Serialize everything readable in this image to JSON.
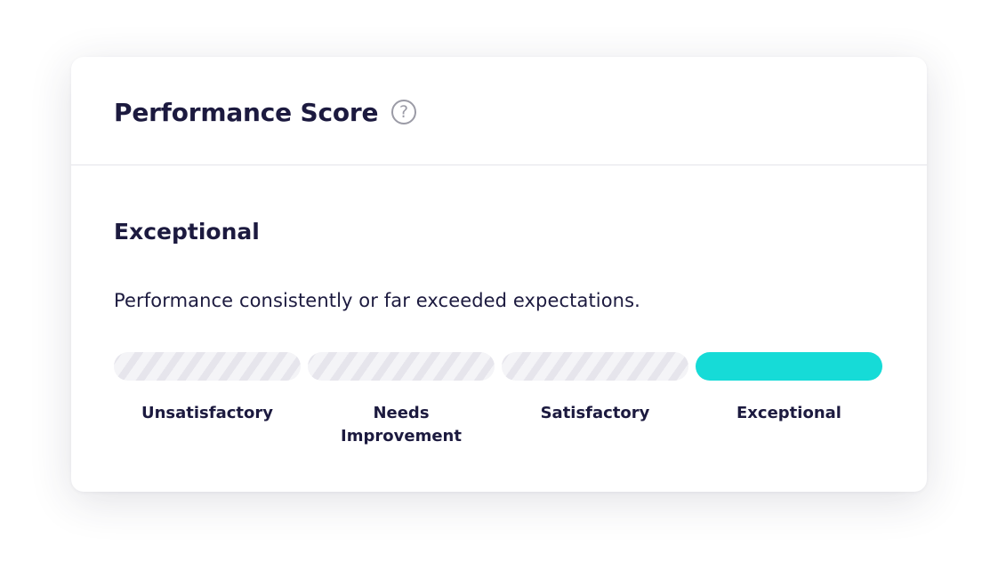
{
  "card": {
    "title": "Performance Score",
    "help_icon": "question-circle-icon"
  },
  "rating": {
    "current": "Exceptional",
    "description": "Performance consistently or far exceeded expectations."
  },
  "scale": {
    "levels": [
      {
        "label": "Unsatisfactory",
        "active": false
      },
      {
        "label": "Needs Improvement",
        "active": false
      },
      {
        "label": "Satisfactory",
        "active": false
      },
      {
        "label": "Exceptional",
        "active": true
      }
    ],
    "selected_index": 3,
    "active_color": "#16dbd7",
    "inactive_pattern": "diagonal-stripes"
  },
  "colors": {
    "text": "#1c1a3f",
    "muted": "#9b9ba6",
    "divider": "#e4e4ea"
  }
}
